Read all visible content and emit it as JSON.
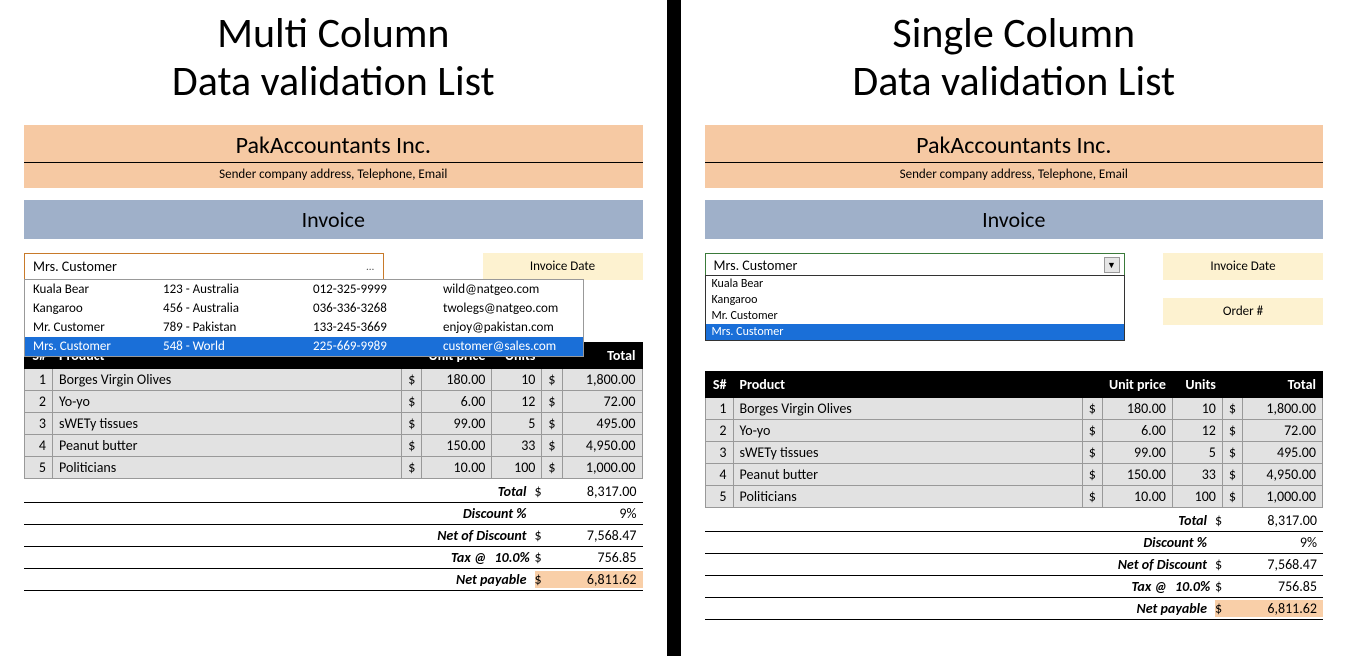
{
  "left": {
    "title_line1": "Multi Column",
    "title_line2": "Data validation List",
    "company_name": "PakAccountants Inc.",
    "company_sub": "Sender company address, Telephone, Email",
    "invoice_label": "Invoice",
    "dd_value": "Mrs. Customer",
    "dd_rows": [
      {
        "name": "Kuala Bear",
        "addr": "123 - Australia",
        "phone": "012-325-9999",
        "email": "wild@natgeo.com",
        "sel": false
      },
      {
        "name": "Kangaroo",
        "addr": "456 - Australia",
        "phone": "036-336-3268",
        "email": "twolegs@natgeo.com",
        "sel": false
      },
      {
        "name": "Mr. Customer",
        "addr": "789 - Pakistan",
        "phone": "133-245-3669",
        "email": "enjoy@pakistan.com",
        "sel": false
      },
      {
        "name": "Mrs. Customer",
        "addr": "548 - World",
        "phone": "225-669-9989",
        "email": "customer@sales.com",
        "sel": true
      }
    ],
    "side_labels": [
      "Invoice Date"
    ],
    "table_headers": {
      "sn": "S#",
      "product": "Product",
      "price": "Unit price",
      "units": "Units",
      "total": "Total"
    },
    "rows": [
      {
        "n": "1",
        "product": "Borges Virgin Olives",
        "cur1": "$",
        "price": "180.00",
        "units": "10",
        "cur2": "$",
        "total": "1,800.00"
      },
      {
        "n": "2",
        "product": "Yo-yo",
        "cur1": "$",
        "price": "6.00",
        "units": "12",
        "cur2": "$",
        "total": "72.00"
      },
      {
        "n": "3",
        "product": "sWETy tissues",
        "cur1": "$",
        "price": "99.00",
        "units": "5",
        "cur2": "$",
        "total": "495.00"
      },
      {
        "n": "4",
        "product": "Peanut butter",
        "cur1": "$",
        "price": "150.00",
        "units": "33",
        "cur2": "$",
        "total": "4,950.00"
      },
      {
        "n": "5",
        "product": "Politicians",
        "cur1": "$",
        "price": "10.00",
        "units": "100",
        "cur2": "$",
        "total": "1,000.00"
      }
    ],
    "summary": {
      "total_label": "Total",
      "total_cur": "$",
      "total_val": "8,317.00",
      "discount_label": "Discount %",
      "discount_val": "9%",
      "net_disc_label": "Net of Discount",
      "net_disc_cur": "$",
      "net_disc_val": "7,568.47",
      "tax_label": "Tax @",
      "tax_rate": "10.0%",
      "tax_cur": "$",
      "tax_val": "756.85",
      "payable_label": "Net payable",
      "payable_cur": "$",
      "payable_val": "6,811.62"
    }
  },
  "right": {
    "title_line1": "Single Column",
    "title_line2": "Data validation List",
    "company_name": "PakAccountants Inc.",
    "company_sub": "Sender company address, Telephone, Email",
    "invoice_label": "Invoice",
    "dd_value": "Mrs. Customer",
    "dd_rows": [
      {
        "name": "Kuala Bear",
        "sel": false
      },
      {
        "name": "Kangaroo",
        "sel": false
      },
      {
        "name": "Mr. Customer",
        "sel": false
      },
      {
        "name": "Mrs. Customer",
        "sel": true
      }
    ],
    "side_labels": [
      "Invoice Date",
      "Order #"
    ],
    "table_headers": {
      "sn": "S#",
      "product": "Product",
      "price": "Unit price",
      "units": "Units",
      "total": "Total"
    },
    "rows": [
      {
        "n": "1",
        "product": "Borges Virgin Olives",
        "cur1": "$",
        "price": "180.00",
        "units": "10",
        "cur2": "$",
        "total": "1,800.00"
      },
      {
        "n": "2",
        "product": "Yo-yo",
        "cur1": "$",
        "price": "6.00",
        "units": "12",
        "cur2": "$",
        "total": "72.00"
      },
      {
        "n": "3",
        "product": "sWETy tissues",
        "cur1": "$",
        "price": "99.00",
        "units": "5",
        "cur2": "$",
        "total": "495.00"
      },
      {
        "n": "4",
        "product": "Peanut butter",
        "cur1": "$",
        "price": "150.00",
        "units": "33",
        "cur2": "$",
        "total": "4,950.00"
      },
      {
        "n": "5",
        "product": "Politicians",
        "cur1": "$",
        "price": "10.00",
        "units": "100",
        "cur2": "$",
        "total": "1,000.00"
      }
    ],
    "summary": {
      "total_label": "Total",
      "total_cur": "$",
      "total_val": "8,317.00",
      "discount_label": "Discount %",
      "discount_val": "9%",
      "net_disc_label": "Net of Discount",
      "net_disc_cur": "$",
      "net_disc_val": "7,568.47",
      "tax_label": "Tax @",
      "tax_rate": "10.0%",
      "tax_cur": "$",
      "tax_val": "756.85",
      "payable_label": "Net payable",
      "payable_cur": "$",
      "payable_val": "6,811.62"
    }
  }
}
